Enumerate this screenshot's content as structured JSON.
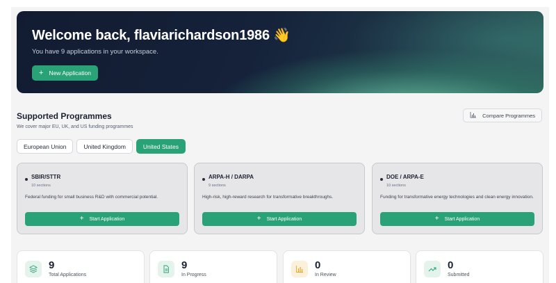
{
  "hero": {
    "title": "Welcome back, flaviarichardson1986",
    "wave_emoji": "👋",
    "subtitle": "You have 9 applications in your workspace.",
    "new_button_label": "New Application"
  },
  "programmes": {
    "title": "Supported Programmes",
    "subtitle": "We cover major EU, UK, and US funding programmes",
    "compare_label": "Compare Programmes",
    "tabs": [
      {
        "label": "European Union",
        "active": false
      },
      {
        "label": "United Kingdom",
        "active": false
      },
      {
        "label": "United States",
        "active": true
      }
    ],
    "cards": [
      {
        "name": "SBIR/STTR",
        "sections": "10 sections",
        "description": "Federal funding for small business R&D with commercial potential.",
        "button": "Start Application"
      },
      {
        "name": "ARPA-H / DARPA",
        "sections": "9 sections",
        "description": "High-risk, high-reward research for transformative breakthroughs.",
        "button": "Start Application"
      },
      {
        "name": "DOE / ARPA-E",
        "sections": "10 sections",
        "description": "Funding for transformative energy technologies and clean energy innovation.",
        "button": "Start Application"
      }
    ]
  },
  "stats": [
    {
      "value": "9",
      "label": "Total Applications",
      "icon": "layers-icon",
      "color": "#2aa277"
    },
    {
      "value": "9",
      "label": "In Progress",
      "icon": "document-icon",
      "color": "#2aa277"
    },
    {
      "value": "0",
      "label": "In Review",
      "icon": "bar-chart-icon",
      "color": "#e3a72f"
    },
    {
      "value": "0",
      "label": "Submitted",
      "icon": "trending-up-icon",
      "color": "#2aa277"
    }
  ],
  "colors": {
    "accent": "#2aa277",
    "hero_dark": "#121b31"
  }
}
